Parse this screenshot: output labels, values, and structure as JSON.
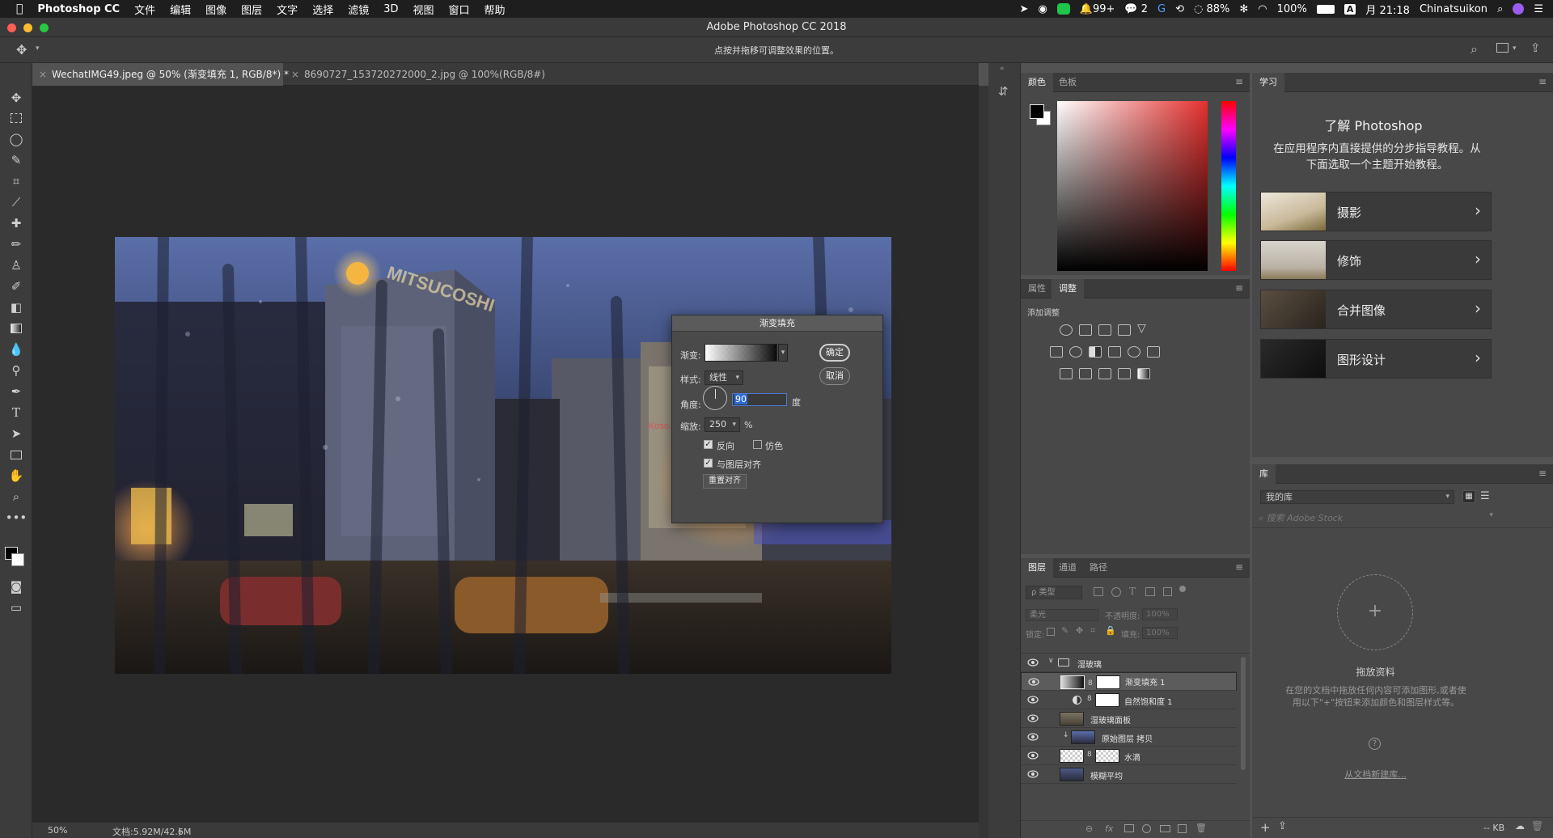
{
  "menubar": {
    "app": "Photoshop CC",
    "menus": [
      "文件",
      "编辑",
      "图像",
      "图层",
      "文字",
      "选择",
      "滤镜",
      "3D",
      "视图",
      "窗口",
      "帮助"
    ],
    "status": {
      "notifications": "99+",
      "wechat": "2",
      "battery_small": "88%",
      "battery_main": "100%",
      "input_method": "A",
      "clock": "月 21:18",
      "user": "Chinatsuikon"
    }
  },
  "window": {
    "title": "Adobe Photoshop CC 2018"
  },
  "options_bar": {
    "hint": "点按并拖移可调整效果的位置。"
  },
  "tabs": [
    {
      "label": "WechatIMG49.jpeg @ 50% (渐变填充 1, RGB/8*) *"
    },
    {
      "label": "8690727_153720272000_2.jpg @ 100%(RGB/8#)"
    }
  ],
  "statusbar": {
    "zoom": "50%",
    "doc": "文档:5.92M/42.6M",
    "arrow": "〉"
  },
  "photo_signs": {
    "building_sign": "MITSUCOSHI",
    "kosu": "Koso"
  },
  "gradient_dialog": {
    "title": "渐变填充",
    "gradient_label": "渐变:",
    "style_label": "样式:",
    "style_value": "线性",
    "angle_label": "角度:",
    "angle_value": "90",
    "angle_unit": "度",
    "scale_label": "缩放:",
    "scale_value": "250",
    "scale_unit": "%",
    "reverse_label": "反向",
    "reverse_checked": true,
    "dither_label": "仿色",
    "dither_checked": false,
    "align_label": "与图层对齐",
    "align_checked": true,
    "reset_align_label": "重置对齐",
    "ok_label": "确定",
    "cancel_label": "取消"
  },
  "color_panel": {
    "tabs": [
      "颜色",
      "色板"
    ],
    "hue_color": "#e4302e"
  },
  "adjustments_panel": {
    "tabs": [
      "属性",
      "调整"
    ],
    "subtitle": "添加调整"
  },
  "layers_panel": {
    "tabs": [
      "图层",
      "通道",
      "路径"
    ],
    "filter_label": "ρ 类型",
    "blend_mode": "柔光",
    "opacity_label": "不透明度:",
    "opacity_value": "100%",
    "lock_label": "锁定:",
    "fill_label": "填充:",
    "fill_value": "100%",
    "layers": [
      {
        "name": "湿玻璃",
        "type": "group"
      },
      {
        "name": "渐变填充 1",
        "type": "adjustment"
      },
      {
        "name": "自然饱和度 1",
        "type": "adjustment"
      },
      {
        "name": "湿玻璃面板",
        "type": "pixel"
      },
      {
        "name": "原始图层 拷贝",
        "type": "pixel"
      },
      {
        "name": "水滴",
        "type": "pixel"
      },
      {
        "name": "模糊平均",
        "type": "pixel"
      }
    ]
  },
  "learn_panel": {
    "tab": "学习",
    "heading": "了解 Photoshop",
    "description": "在应用程序内直接提供的分步指导教程。从下面选取一个主题开始教程。",
    "cards": [
      {
        "label": "摄影"
      },
      {
        "label": "修饰"
      },
      {
        "label": "合并图像"
      },
      {
        "label": "图形设计"
      }
    ]
  },
  "library_panel": {
    "tab": "库",
    "library_select": "我的库",
    "search_placeholder": "搜索 Adobe Stock",
    "drop_title": "拖放资料",
    "drop_desc": "在您的文档中拖放任何内容可添加图形,或者使用以下\"+\"按钮来添加颜色和图层样式等。",
    "create_link": "从文档新建库...",
    "size_label": "-- KB"
  }
}
